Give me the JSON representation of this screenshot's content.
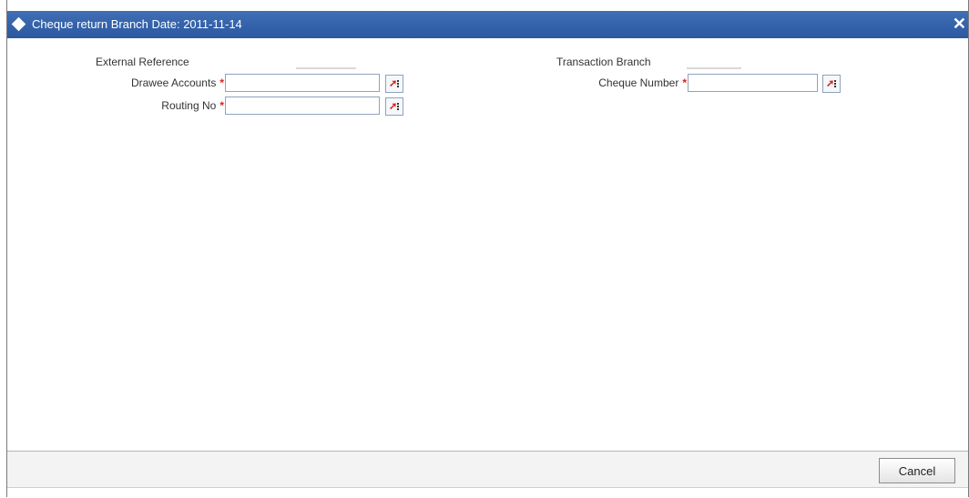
{
  "window": {
    "title": "Cheque return  Branch Date: 2011-11-14",
    "close_glyph": "✕"
  },
  "form": {
    "external_reference": {
      "label": "External Reference",
      "value": ""
    },
    "transaction_branch": {
      "label": "Transaction Branch",
      "value": ""
    },
    "drawee_accounts": {
      "label": "Drawee Accounts",
      "value": "",
      "required_mark": "*"
    },
    "routing_no": {
      "label": "Routing No",
      "value": "",
      "required_mark": "*"
    },
    "cheque_number": {
      "label": "Cheque Number",
      "value": "",
      "required_mark": "*"
    }
  },
  "footer": {
    "cancel_label": "Cancel"
  },
  "icons": {
    "title": "diamond-icon",
    "close": "close-icon",
    "lov": "lov-icon"
  },
  "colors": {
    "titlebar": "#2c58a0",
    "required": "#e0201a",
    "lov_arrow": "#d8231b"
  }
}
